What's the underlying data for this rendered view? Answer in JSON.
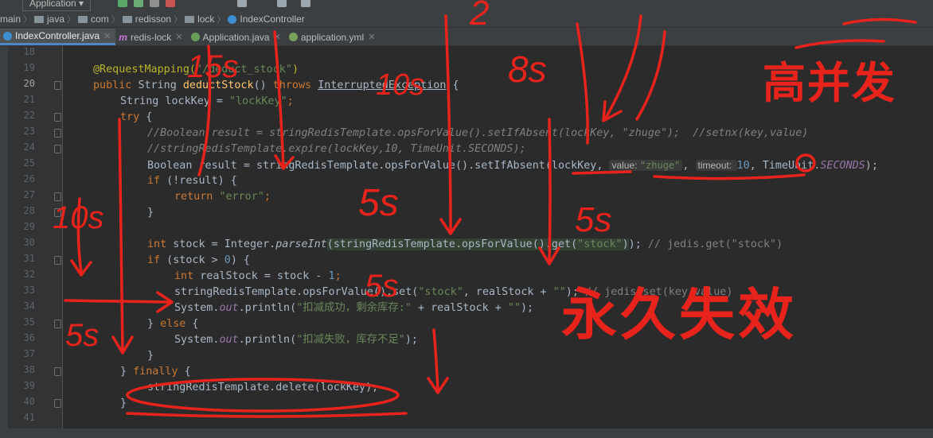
{
  "toolbar": {
    "run_config": "Application ▾"
  },
  "breadcrumb": [
    "main",
    "java",
    "com",
    "redisson",
    "lock",
    "IndexController"
  ],
  "tabs": [
    {
      "label": "IndexController.java",
      "active": true,
      "icon": "class-icon"
    },
    {
      "label": "redis-lock",
      "active": false,
      "icon": "maven-module-icon"
    },
    {
      "label": "Application.java",
      "active": false,
      "icon": "spring-class-icon"
    },
    {
      "label": "application.yml",
      "active": false,
      "icon": "yaml-icon"
    }
  ],
  "line_numbers": [
    "18",
    "19",
    "20",
    "21",
    "22",
    "23",
    "24",
    "25",
    "26",
    "27",
    "28",
    "29",
    "30",
    "31",
    "32",
    "33",
    "34",
    "35",
    "36",
    "37",
    "38",
    "39",
    "40",
    "41"
  ],
  "current_line": "20",
  "code": {
    "l19_annotation": "@RequestMapping(",
    "l19_arg": "\"/deduct_stock\"",
    "l19_close": ")",
    "l20_public": "public ",
    "l20_type": "String ",
    "l20_method": "deductStock",
    "l20_parens": "() ",
    "l20_throws": "throws ",
    "l20_exc": "InterruptedException",
    "l20_brace": " {",
    "l21_decl": "String lockKey = ",
    "l21_value": "\"lockKey\"",
    "l21_semi": ";",
    "l22_try": "try",
    "l22_brace": " {",
    "l23_comment": "//Boolean result = stringRedisTemplate.opsForValue().setIfAbsent(lockKey, \"zhuge\");  //setnx(key,value)",
    "l24_comment": "//stringRedisTemplate.expire(lockKey,10, TimeUnit.SECONDS);",
    "l25_code": "Boolean result = stringRedisTemplate.opsForValue().setIfAbsent(lockKey, ",
    "l25_hint_value_label": "value: ",
    "l25_hint_value": "\"zhuge\"",
    "l25_comma": ", ",
    "l25_hint_timeout_label": "timeout: ",
    "l25_hint_timeout": "10",
    "l25_tail": ", TimeUnit.",
    "l25_seconds": "SECONDS",
    "l25_end": ");",
    "l26_if": "if",
    "l26_cond": " (!result) {",
    "l27_return": "return ",
    "l27_value": "\"error\"",
    "l27_semi": ";",
    "l28_close": "}",
    "l30_int": "int ",
    "l30_decl": "stock = Integer.",
    "l30_parse": "parseInt",
    "l30_open": "(",
    "l30_call": "stringRedisTemplate.opsForValue().get(",
    "l30_key": "\"stock\"",
    "l30_close": ")",
    "l30_semi": "); ",
    "l30_comment": "// jedis.get(\"stock\")",
    "l31_if": "if",
    "l31_cond": " (stock > ",
    "l31_num": "0",
    "l31_brace": ") {",
    "l32_int": "int ",
    "l32_decl": "realStock = stock - ",
    "l32_num": "1",
    "l32_semi": ";",
    "l33_call": "stringRedisTemplate.opsForValue().set(",
    "l33_key": "\"stock\"",
    "l33_mid": ", realStock + ",
    "l33_empty": "\"\"",
    "l33_semi": "); ",
    "l33_comment": "// jedis.set(key,value)",
    "l34_sys": "System.",
    "l34_out": "out",
    "l34_print": ".println(",
    "l34_msg": "\"扣减成功，剩余库存:\"",
    "l34_mid": " + realStock + ",
    "l34_empty": "\"\"",
    "l34_end": ");",
    "l35_else_close": "} ",
    "l35_else": "else",
    "l35_brace": " {",
    "l36_sys": "System.",
    "l36_out": "out",
    "l36_print": ".println(",
    "l36_msg": "\"扣减失败，库存不足\"",
    "l36_end": ");",
    "l37_close": "}",
    "l38_close": "} ",
    "l38_finally": "finally",
    "l38_brace": " {",
    "l39_code": "stringRedisTemplate.delete(lockKey);",
    "l40_close": "}"
  },
  "annotations": {
    "t1": "15s",
    "t2": "10s",
    "t3": "8s",
    "t4": "2",
    "t5": "10s",
    "t6": "5s",
    "t7": "5s",
    "t8": "5s",
    "t9": "5s",
    "high_concurrency": "高并发",
    "permanent_failure": "永久失效"
  },
  "colors": {
    "keyword": "#cc7832",
    "string": "#6a8759",
    "comment": "#808080",
    "annotation": "#bbb529",
    "method": "#ffc66d",
    "ink": "#e8231c"
  }
}
